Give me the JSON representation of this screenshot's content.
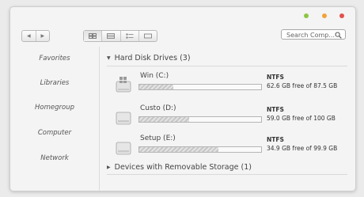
{
  "window": {
    "controls": [
      {
        "name": "minimize",
        "color": "#8cc542"
      },
      {
        "name": "maximize",
        "color": "#f3a23c"
      },
      {
        "name": "close",
        "color": "#e3504a"
      }
    ]
  },
  "toolbar": {
    "nav_back": "◀",
    "nav_forward": "▶",
    "views": [
      "large-icons",
      "details",
      "list",
      "tiles"
    ],
    "active_view": "large-icons"
  },
  "search": {
    "placeholder": "Search Comp..."
  },
  "sidebar": {
    "items": [
      {
        "label": "Favorites"
      },
      {
        "label": "Libraries"
      },
      {
        "label": "Homegroup"
      },
      {
        "label": "Computer"
      },
      {
        "label": "Network"
      }
    ]
  },
  "content": {
    "groups": [
      {
        "label": "Hard Disk Drives (3)",
        "expanded": true
      },
      {
        "label": "Devices with Removable Storage (1)",
        "expanded": false
      }
    ],
    "drives": [
      {
        "name": "Win (C:)",
        "fs": "NTFS",
        "free": "62.6 GB free of 87.5 GB",
        "used_fraction": 0.28,
        "icon": "windows-drive-icon"
      },
      {
        "name": "Custo (D:)",
        "fs": "NTFS",
        "free": "59.0 GB free of 100 GB",
        "used_fraction": 0.41,
        "icon": "hard-drive-icon"
      },
      {
        "name": "Setup (E:)",
        "fs": "NTFS",
        "free": "34.9 GB free of 99.9 GB",
        "used_fraction": 0.65,
        "icon": "hard-drive-icon"
      }
    ]
  }
}
